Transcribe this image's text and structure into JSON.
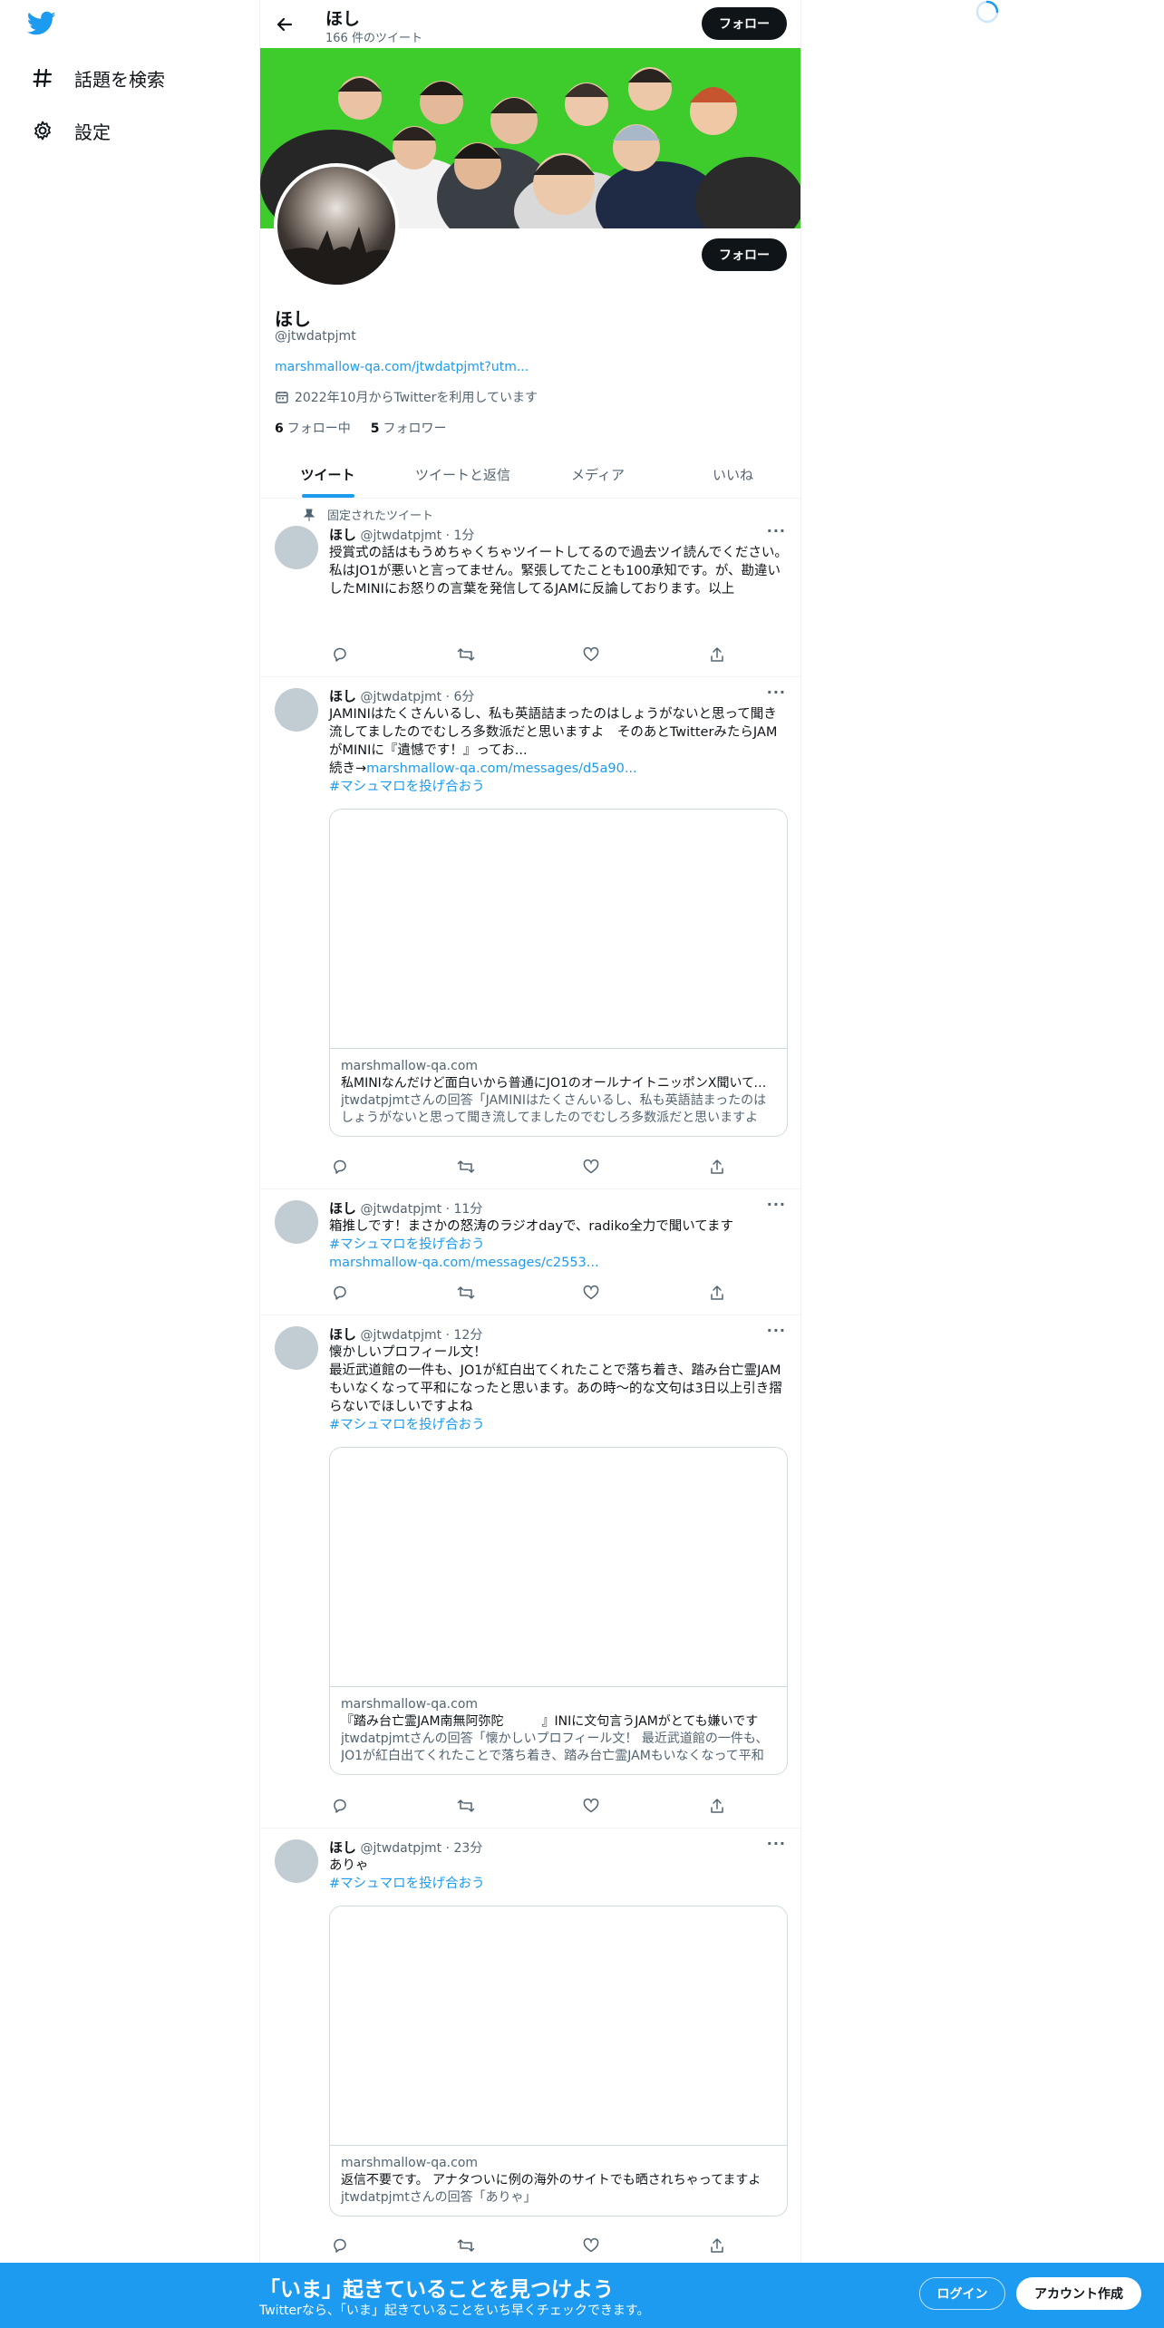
{
  "colors": {
    "accent": "#1d9bf0",
    "text": "#0f1419",
    "muted": "#536471",
    "banner_green": "#3ecb2c"
  },
  "nav": {
    "logo_icon": "twitter-bird-icon",
    "items": [
      {
        "icon": "hashtag-icon",
        "label": "話題を検索"
      },
      {
        "icon": "gear-icon",
        "label": "設定"
      }
    ]
  },
  "header": {
    "name": "ほし",
    "tweet_count": "166 件のツイート",
    "follow_label": "フォロー"
  },
  "profile": {
    "name": "ほし",
    "handle": "@jtwdatpjmt",
    "link": "marshmallow-qa.com/jtwdatpjmt?utm...",
    "joined": "2022年10月からTwitterを利用しています",
    "following_count": "6",
    "following_label": "フォロー中",
    "followers_count": "5",
    "followers_label": "フォロワー",
    "follow_label": "フォロー"
  },
  "tabs": [
    {
      "label": "ツイート",
      "active": true
    },
    {
      "label": "ツイートと返信",
      "active": false
    },
    {
      "label": "メディア",
      "active": false
    },
    {
      "label": "いいね",
      "active": false
    }
  ],
  "tweets": [
    {
      "pinned_label": "固定されたツイート",
      "name": "ほし",
      "meta": "@jtwdatpjmt · 1分",
      "lines": [
        "授賞式の話はもうめちゃくちゃツイートしてるので過去ツイ読んでください。",
        "私はJO1が悪いと言ってません。緊張してたことも100承知です。が、勘違いしたMINIにお怒りの言葉を発信してるJAMに反論しております。以上"
      ]
    },
    {
      "name": "ほし",
      "meta": "@jtwdatpjmt · 6分",
      "lines": [
        "JAMINIはたくさんいるし、私も英語詰まったのはしょうがないと思って聞き流してましたのでむしろ多数派だと思いますよ　そのあとTwitterみたらJAMがMINIに『遺憾です！』ってお..."
      ],
      "more_prefix": "続き→",
      "more_link": "marshmallow-qa.com/messages/d5a90...",
      "hashtag": "#マシュマロを投げ合おう",
      "card": {
        "domain": "marshmallow-qa.com",
        "title": "私MINIなんだけど面白いから普通にJO1のオールナイトニッポンX聞いてます",
        "desc": "jtwdatpjmtさんの回答「JAMINIはたくさんいるし、私も英語詰まったのはしょうがないと思って聞き流してましたのでむしろ多数派だと思いますよ"
      }
    },
    {
      "name": "ほし",
      "meta": "@jtwdatpjmt · 11分",
      "lines": [
        "箱推しです！まさかの怒涛のラジオdayで、radiko全力で聞いてます"
      ],
      "hashtag": "#マシュマロを投げ合おう",
      "link": "marshmallow-qa.com/messages/c2553..."
    },
    {
      "name": "ほし",
      "meta": "@jtwdatpjmt · 12分",
      "lines": [
        "懐かしいプロフィール文！",
        "最近武道館の一件も、JO1が紅白出てくれたことで落ち着き、踏み台亡霊JAMもいなくなって平和になったと思います。あの時〜的な文句は3日以上引き摺らないでほしいですよね"
      ],
      "hashtag": "#マシュマロを投げ合おう",
      "card": {
        "domain": "marshmallow-qa.com",
        "title": "『踏み台亡霊JAM南無阿弥陀　　　』INIに文句言うJAMがとても嫌いです",
        "desc": "jtwdatpjmtさんの回答「懐かしいプロフィール文！ 最近武道館の一件も、JO1が紅白出てくれたことで落ち着き、踏み台亡霊JAMもいなくなって平和に"
      }
    },
    {
      "name": "ほし",
      "meta": "@jtwdatpjmt · 23分",
      "lines": [
        "ありゃ"
      ],
      "hashtag": "#マシュマロを投げ合おう",
      "card": {
        "domain": "marshmallow-qa.com",
        "title": "返信不要です。 アナタついに例の海外のサイトでも晒されちゃってますよ",
        "desc": "jtwdatpjmtさんの回答「ありゃ」"
      }
    }
  ],
  "bottom_bar": {
    "title": "「いま」起きていることを見つけよう",
    "subtitle": "Twitterなら、「いま」起きていることをいち早くチェックできます。",
    "login_label": "ログイン",
    "signup_label": "アカウント作成"
  }
}
